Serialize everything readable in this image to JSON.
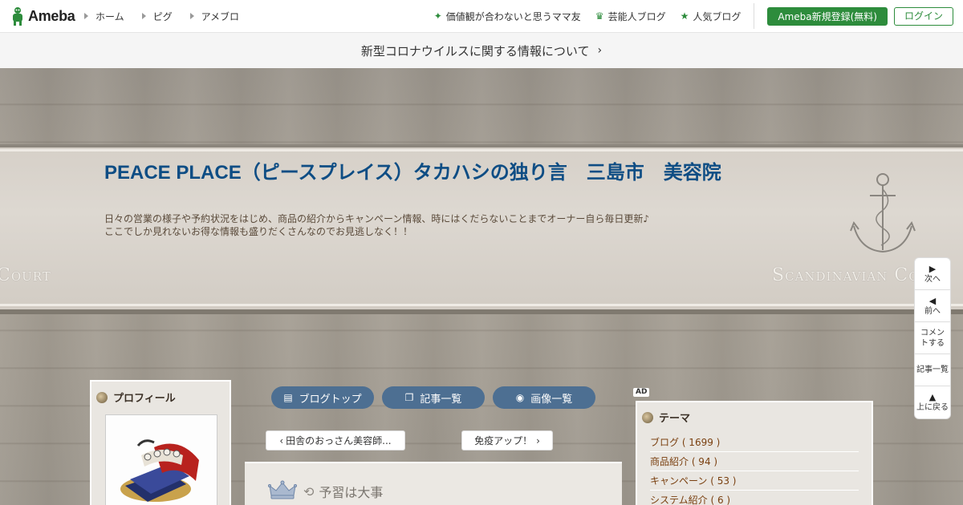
{
  "header": {
    "logo": "Ameba",
    "nav": [
      "ホーム",
      "ピグ",
      "アメブロ"
    ],
    "links": [
      {
        "label": "価値観が合わないと思うママ友",
        "icon": "sparkle-icon"
      },
      {
        "label": "芸能人ブログ",
        "icon": "crown-icon"
      },
      {
        "label": "人気ブログ",
        "icon": "star-icon"
      }
    ],
    "register_label": "Ameba新規登録(無料)",
    "login_label": "ログイン"
  },
  "notice": {
    "text": "新型コロナウイルスに関する情報について",
    "chevron": "›"
  },
  "blog": {
    "title": "PEACE PLACE（ピースプレイス）タカハシの独り言　三島市　美容院",
    "description_line1": "日々の営業の様子や予約状況をはじめ、商品の紹介からキャンペーン情報、時にはくだらないことまでオーナー自ら毎日更新♪",
    "description_line2": "ここでしか見れないお得な情報も盛りだくさんなのでお見逃しなく！！",
    "banner_left": "Court",
    "banner_right": "Scandinavian Cou"
  },
  "sidenav": [
    {
      "arrow": "▶",
      "label": "次へ"
    },
    {
      "arrow": "◀",
      "label": "前へ"
    },
    {
      "arrow": "",
      "label": "コメントする"
    },
    {
      "arrow": "",
      "label": "記事一覧"
    },
    {
      "arrow": "▲",
      "label": "上に戻る"
    }
  ],
  "profile": {
    "heading": "プロフィール"
  },
  "center": {
    "pills": [
      {
        "label": "ブログトップ",
        "icon": "document-icon"
      },
      {
        "label": "記事一覧",
        "icon": "copy-icon"
      },
      {
        "label": "画像一覧",
        "icon": "camera-icon"
      }
    ],
    "prev_label": "田舎のおっさん美容師...",
    "next_label": "免疫アップ！",
    "article_title": "予習は大事"
  },
  "ad": "AD",
  "theme": {
    "heading": "テーマ",
    "items": [
      "ブログ ( 1699 )",
      "商品紹介 ( 94 )",
      "キャンペーン ( 53 )",
      "システム紹介 ( 6 )"
    ]
  }
}
